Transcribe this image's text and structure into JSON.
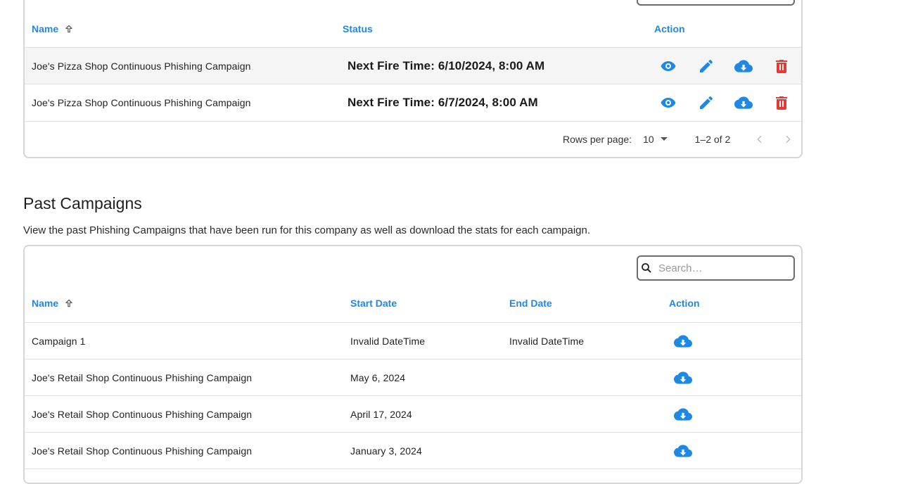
{
  "top_table": {
    "headers": {
      "name": "Name",
      "status": "Status",
      "action": "Action"
    },
    "rows": [
      {
        "name": "Joe's Pizza Shop Continuous Phishing Campaign",
        "status": "Next Fire Time: 6/10/2024, 8:00 AM"
      },
      {
        "name": "Joe's Pizza Shop Continuous Phishing Campaign",
        "status": "Next Fire Time: 6/7/2024, 8:00 AM"
      }
    ],
    "pagination": {
      "rows_per_page_label": "Rows per page:",
      "rows_per_page": "10",
      "range": "1–2 of 2"
    }
  },
  "past": {
    "title": "Past Campaigns",
    "description": "View the past Phishing Campaigns that have been run for this company as well as download the stats for each campaign.",
    "search_placeholder": "Search…",
    "headers": {
      "name": "Name",
      "start": "Start Date",
      "end": "End Date",
      "action": "Action"
    },
    "rows": [
      {
        "name": "Campaign 1",
        "start": "Invalid DateTime",
        "end": "Invalid DateTime"
      },
      {
        "name": "Joe's Retail Shop Continuous Phishing Campaign",
        "start": "May 6, 2024",
        "end": ""
      },
      {
        "name": "Joe's Retail Shop Continuous Phishing Campaign",
        "start": "April 17, 2024",
        "end": ""
      },
      {
        "name": "Joe's Retail Shop Continuous Phishing Campaign",
        "start": "January 3, 2024",
        "end": ""
      }
    ]
  },
  "icons": {
    "view": "eye-icon",
    "edit": "pencil-icon",
    "download": "cloud-download-icon",
    "delete": "trash-icon",
    "sort": "arrow-up-icon",
    "search": "search-icon"
  },
  "colors": {
    "accent": "#1e88e5",
    "delete": "#e53935",
    "header_text": "#1e88e5"
  }
}
